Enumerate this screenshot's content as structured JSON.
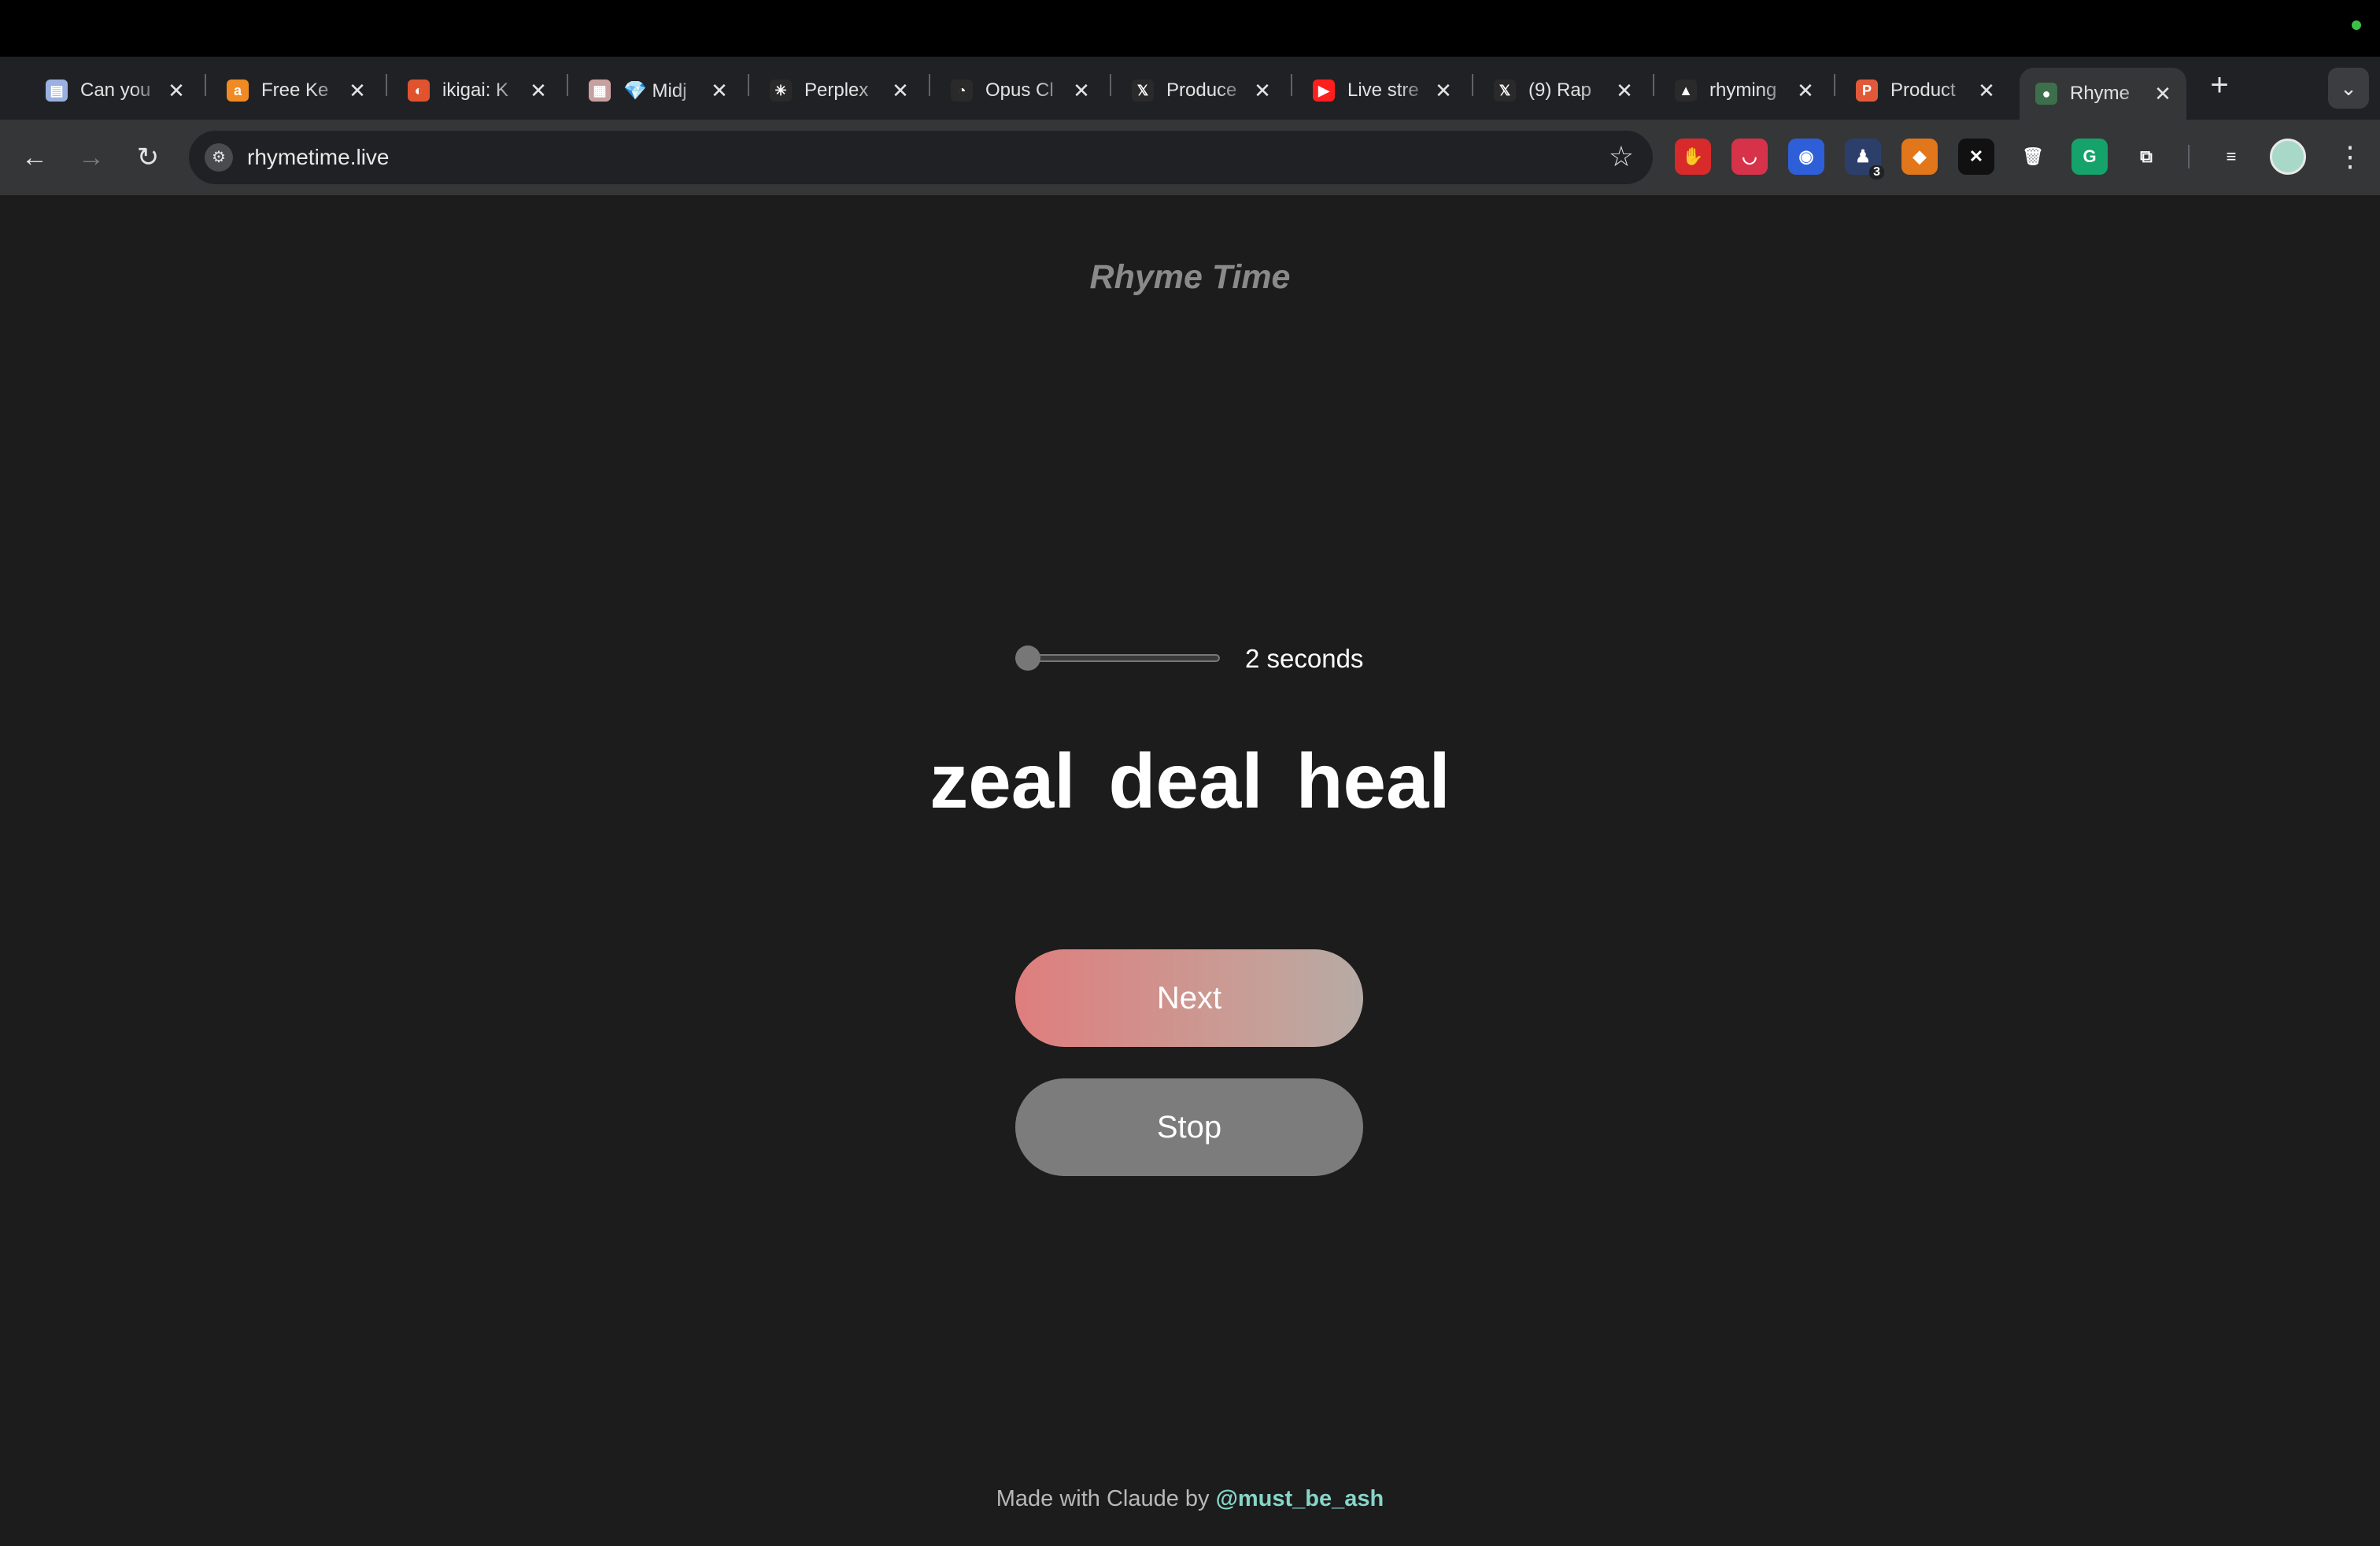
{
  "browser": {
    "tabs": [
      {
        "title": "Can you",
        "favicon_color": "#9ab0e0",
        "icon": "document-icon",
        "glyph": "▤"
      },
      {
        "title": "Free Ke",
        "favicon_color": "#f08a24",
        "icon": "amazon-icon",
        "glyph": "a"
      },
      {
        "title": "ikigai: K",
        "favicon_color": "#e0532e",
        "icon": "semrush-icon",
        "glyph": "◐"
      },
      {
        "title": "💎 Midj",
        "favicon_color": "#c8a0a0",
        "icon": "image-thumb-icon",
        "glyph": "▦"
      },
      {
        "title": "Perplex",
        "favicon_color": "#2a2a2a",
        "icon": "perplexity-icon",
        "glyph": "✳"
      },
      {
        "title": "Opus Cl",
        "favicon_color": "#2a2a2a",
        "icon": "opus-clip-icon",
        "glyph": "◔"
      },
      {
        "title": "Produce",
        "favicon_color": "#2a2a2a",
        "icon": "x-logo-icon",
        "glyph": "𝕏"
      },
      {
        "title": "Live stre",
        "favicon_color": "#ff1e1e",
        "icon": "youtube-icon",
        "glyph": "▶"
      },
      {
        "title": "(9) Rap",
        "favicon_color": "#2a2a2a",
        "icon": "x-logo-icon",
        "glyph": "𝕏"
      },
      {
        "title": "rhyming",
        "favicon_color": "#2a2a2a",
        "icon": "triangle-logo-icon",
        "glyph": "▲"
      },
      {
        "title": "Product",
        "favicon_color": "#e2593a",
        "icon": "product-hunt-icon",
        "glyph": "P"
      },
      {
        "title": "Rhyme",
        "favicon_color": "#3d6f4c",
        "icon": "rhyme-time-favicon-icon",
        "glyph": "●",
        "active": true
      }
    ],
    "url": "rhymetime.live",
    "new_tab": "+",
    "extensions": [
      {
        "name": "stop-extension-icon",
        "color": "#d82a2a",
        "glyph": "✋"
      },
      {
        "name": "pocket-extension-icon",
        "color": "#d6334a",
        "glyph": "◡"
      },
      {
        "name": "circle-extension-icon",
        "color": "#2e5fd8",
        "glyph": "◉"
      },
      {
        "name": "badge-extension-icon",
        "color": "#2c3f6b",
        "glyph": "♟",
        "badge": "3"
      },
      {
        "name": "metamask-extension-icon",
        "color": "#e2761b",
        "glyph": "◆"
      },
      {
        "name": "x-extension-icon",
        "color": "#111111",
        "glyph": "✕"
      },
      {
        "name": "trash-extension-icon",
        "color": "#353638",
        "glyph": "🗑"
      },
      {
        "name": "grammarly-extension-icon",
        "color": "#15a36b",
        "glyph": "G"
      },
      {
        "name": "puzzle-extension-icon",
        "color": "#353638",
        "glyph": "⧉"
      }
    ]
  },
  "app": {
    "title": "Rhyme Time",
    "speed": {
      "label": "2 seconds",
      "value": 2,
      "min": 2,
      "max": 10
    },
    "words": [
      "zeal",
      "deal",
      "heal"
    ],
    "next_label": "Next",
    "stop_label": "Stop",
    "footer": {
      "text": "Made with Claude by ",
      "handle": "@must_be_ash"
    }
  },
  "colors": {
    "page_bg": "#1c1c1c",
    "next_gradient_start": "#df7e7e",
    "next_gradient_end": "#b6aba5",
    "stop_bg": "#7c7c7c",
    "footer_handle": "#86d6c8"
  }
}
